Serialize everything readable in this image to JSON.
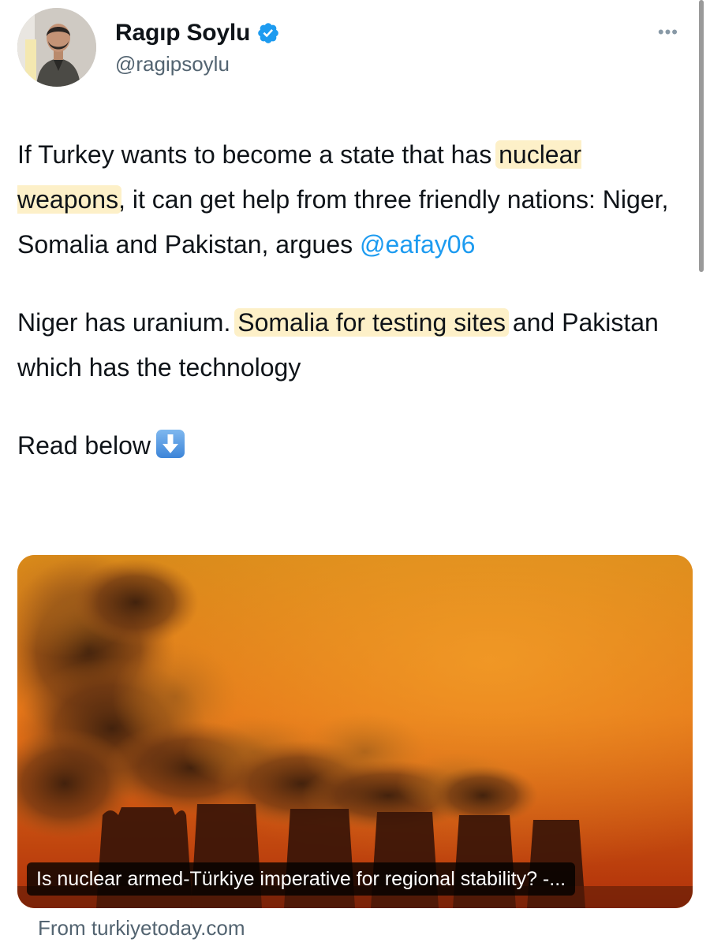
{
  "author": {
    "name": "Ragıp Soylu",
    "handle": "@ragipsoylu",
    "avatar_icon": "avatar-photo",
    "verified": true,
    "verified_color": "#1d9bf0"
  },
  "tweet": {
    "p1": {
      "before": "If Turkey wants to become a state that has ",
      "highlight": "nuclear weapons",
      "after": ", it can get help from three friendly nations: Niger, Somalia and Pakistan, argues ",
      "mention": "@eafay06"
    },
    "p2": {
      "before": "Niger has uranium. ",
      "highlight": "Somalia for testing sites",
      "after": " and Pakistan which has the technology"
    },
    "p3": {
      "text": "Read below",
      "emoji_icon": "down-arrow-emoji"
    }
  },
  "link_card": {
    "title": "Is nuclear armed-Türkiye imperative for regional stability? -...",
    "source": "From turkiyetoday.com",
    "image_icon": "cooling-towers-smoke-sunset"
  },
  "colors": {
    "highlight": "#fdf0c8",
    "mention": "#1d9bf0",
    "secondary_text": "#536471"
  }
}
